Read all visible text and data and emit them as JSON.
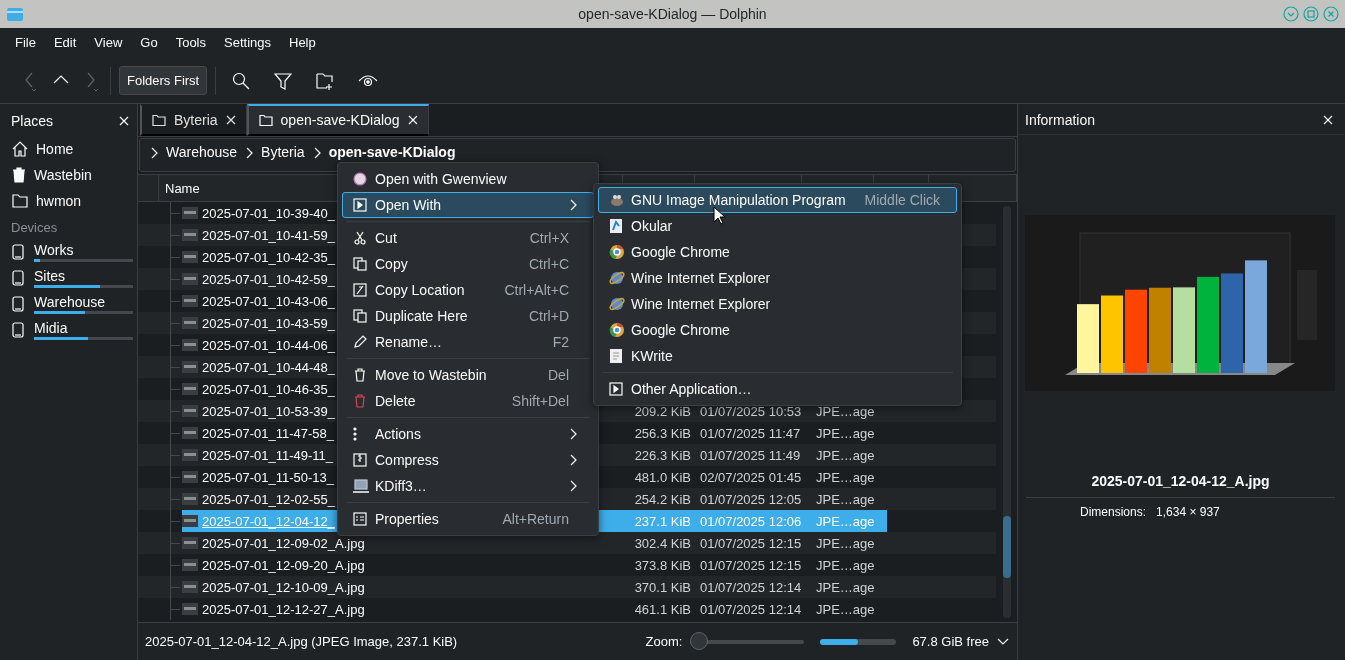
{
  "window": {
    "title": "open-save-KDialog — Dolphin"
  },
  "menubar": [
    "File",
    "Edit",
    "View",
    "Go",
    "Tools",
    "Settings",
    "Help"
  ],
  "toolbar": {
    "nav": [
      {
        "disabled": true
      },
      {
        "disabled": false
      },
      {
        "disabled": true
      }
    ],
    "sort_button": "Folders First"
  },
  "places": {
    "title": "Places",
    "items": [
      {
        "label": "Home"
      },
      {
        "label": "Wastebin"
      },
      {
        "label": "hwmon"
      }
    ],
    "devices_title": "Devices",
    "devices": [
      {
        "label": "Works",
        "level": 0.06
      },
      {
        "label": "Sites",
        "level": 0.67
      },
      {
        "label": "Warehouse",
        "level": 0.52
      },
      {
        "label": "Midia",
        "level": 0.55
      }
    ]
  },
  "tabs": [
    {
      "label": "Byteria",
      "selected": false
    },
    {
      "label": "open-save-KDialog",
      "selected": true
    }
  ],
  "breadcrumb": [
    "Warehouse",
    "Byteria",
    "open-save-KDialog"
  ],
  "table": {
    "columns": [
      "Name"
    ],
    "rows": [
      {
        "name": "2025-07-01_10-39-40_",
        "selected": false
      },
      {
        "name": "2025-07-01_10-41-59_",
        "selected": false
      },
      {
        "name": "2025-07-01_10-42-35_",
        "selected": false
      },
      {
        "name": "2025-07-01_10-42-59_",
        "selected": false
      },
      {
        "name": "2025-07-01_10-43-06_",
        "selected": false
      },
      {
        "name": "2025-07-01_10-43-59_",
        "selected": false
      },
      {
        "name": "2025-07-01_10-44-06_",
        "selected": false
      },
      {
        "name": "2025-07-01_10-44-48_",
        "selected": false
      },
      {
        "name": "2025-07-01_10-46-35_",
        "selected": false
      },
      {
        "name": "2025-07-01_10-53-39_",
        "size": "209.2 KiB",
        "modified": "01/07/2025 10:53",
        "type": "JPE…age",
        "selected": false
      },
      {
        "name": "2025-07-01_11-47-58_",
        "size": "256.3 KiB",
        "modified": "01/07/2025 11:47",
        "type": "JPE…age",
        "selected": false
      },
      {
        "name": "2025-07-01_11-49-11_",
        "size": "226.3 KiB",
        "modified": "01/07/2025 11:49",
        "type": "JPE…age",
        "selected": false
      },
      {
        "name": "2025-07-01_11-50-13_",
        "size": "481.0 KiB",
        "modified": "02/07/2025 01:45",
        "type": "JPE…age",
        "selected": false
      },
      {
        "name": "2025-07-01_12-02-55_",
        "size": "254.2 KiB",
        "modified": "01/07/2025 12:05",
        "type": "JPE…age",
        "selected": false
      },
      {
        "name": "2025-07-01_12-04-12_",
        "size": "237.1 KiB",
        "modified": "01/07/2025 12:06",
        "type": "JPE…age",
        "selected": true
      },
      {
        "name": "2025-07-01_12-09-02_A.jpg",
        "size": "302.4 KiB",
        "modified": "01/07/2025 12:15",
        "type": "JPE…age",
        "selected": false
      },
      {
        "name": "2025-07-01_12-09-20_A.jpg",
        "size": "373.8 KiB",
        "modified": "01/07/2025 12:15",
        "type": "JPE…age",
        "selected": false
      },
      {
        "name": "2025-07-01_12-10-09_A.jpg",
        "size": "370.1 KiB",
        "modified": "01/07/2025 12:14",
        "type": "JPE…age",
        "selected": false
      },
      {
        "name": "2025-07-01_12-12-27_A.jpg",
        "size": "461.1 KiB",
        "modified": "01/07/2025 12:14",
        "type": "JPE…age",
        "selected": false
      }
    ]
  },
  "context_menu": {
    "groups": [
      [
        {
          "label": "Open with Gwenview",
          "submenu": false,
          "selected": false
        },
        {
          "label": "Open With",
          "submenu": true,
          "selected": true
        }
      ],
      [
        {
          "label": "Cut",
          "shortcut": "Ctrl+X",
          "submenu": false,
          "selected": false
        },
        {
          "label": "Copy",
          "shortcut": "Ctrl+C",
          "submenu": false,
          "selected": false
        },
        {
          "label": "Copy Location",
          "shortcut": "Ctrl+Alt+C",
          "submenu": false,
          "selected": false
        },
        {
          "label": "Duplicate Here",
          "shortcut": "Ctrl+D",
          "submenu": false,
          "selected": false
        },
        {
          "label": "Rename…",
          "shortcut": "F2",
          "submenu": false,
          "selected": false
        }
      ],
      [
        {
          "label": "Move to Wastebin",
          "shortcut": "Del",
          "submenu": false,
          "selected": false
        },
        {
          "label": "Delete",
          "shortcut": "Shift+Del",
          "submenu": false,
          "selected": false
        }
      ],
      [
        {
          "label": "Actions",
          "submenu": true,
          "selected": false
        },
        {
          "label": "Compress",
          "submenu": true,
          "selected": false
        },
        {
          "label": "KDiff3…",
          "submenu": true,
          "selected": false
        }
      ],
      [
        {
          "label": "Properties",
          "shortcut": "Alt+Return",
          "submenu": false,
          "selected": false
        }
      ]
    ]
  },
  "submenu": {
    "groups": [
      [
        {
          "label": "GNU Image Manipulation Program",
          "shortcut": "Middle Click",
          "selected": true
        },
        {
          "label": "Okular",
          "selected": false
        },
        {
          "label": "Google Chrome",
          "selected": false
        },
        {
          "label": "Wine Internet Explorer",
          "selected": false
        },
        {
          "label": "Wine Internet Explorer",
          "selected": false
        },
        {
          "label": "Google Chrome",
          "selected": false
        },
        {
          "label": "KWrite",
          "selected": false
        }
      ],
      [
        {
          "label": "Other Application…",
          "selected": false
        }
      ]
    ]
  },
  "info": {
    "title": "Information",
    "file_name": "2025-07-01_12-04-12_A.jpg",
    "properties": [
      {
        "label": "Dimensions:",
        "value": "1,634 × 937"
      }
    ]
  },
  "status_bar": {
    "text": "2025-07-01_12-04-12_A.jpg (JPEG Image, 237.1 KiB)",
    "zoom_label": "Zoom:",
    "zoom": {
      "level": 0
    },
    "space": {
      "level": 0.5
    },
    "free": "67.8 GiB free"
  }
}
